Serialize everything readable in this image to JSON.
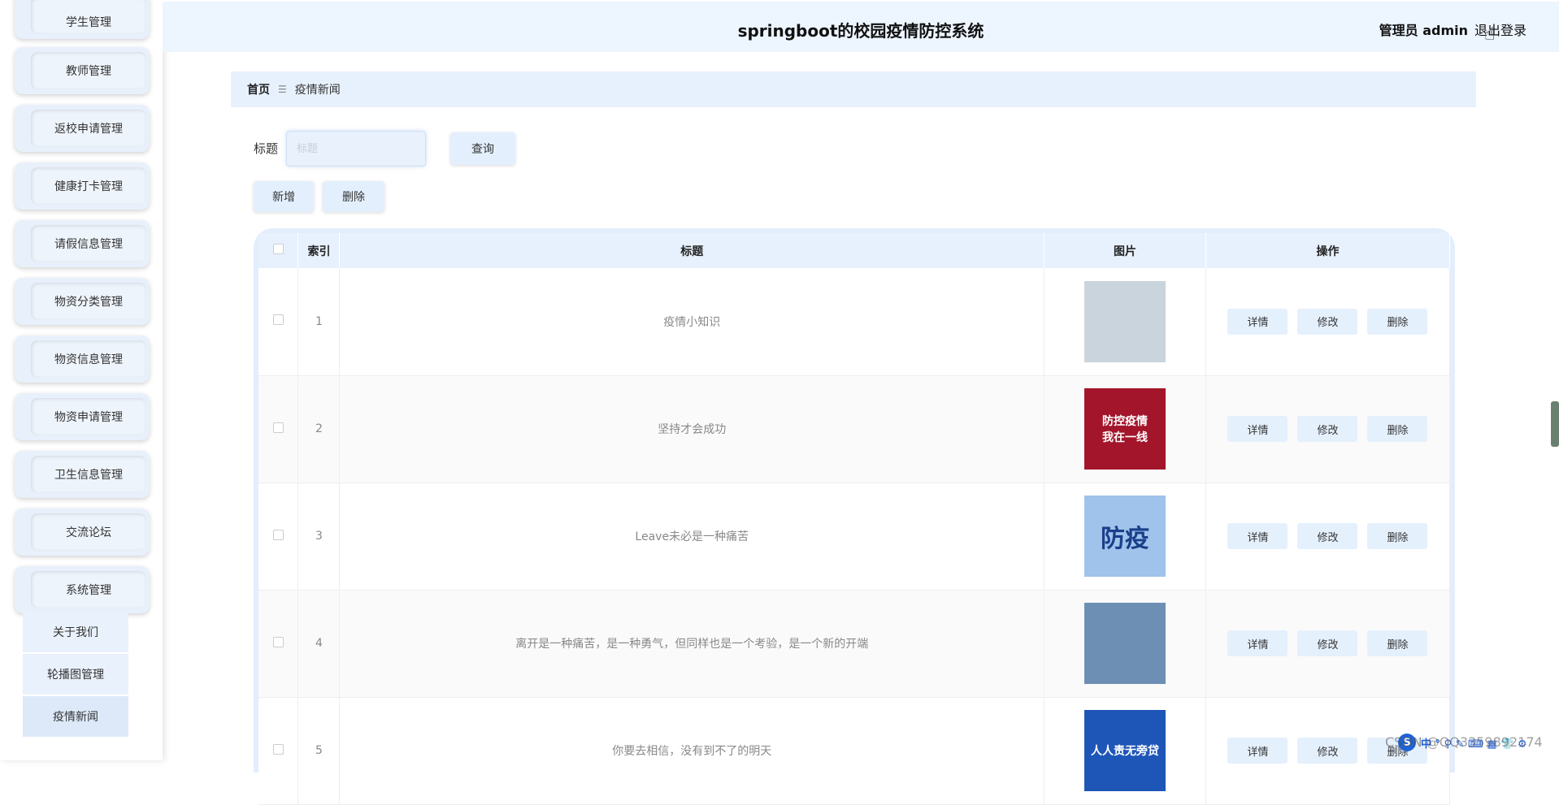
{
  "app": {
    "title": "springboot的校园疫情防控系统",
    "user": "管理员 admin",
    "logout": "退出登录"
  },
  "sidebar": {
    "items": [
      {
        "label": "学生管理"
      },
      {
        "label": "教师管理"
      },
      {
        "label": "返校申请管理"
      },
      {
        "label": "健康打卡管理"
      },
      {
        "label": "请假信息管理"
      },
      {
        "label": "物资分类管理"
      },
      {
        "label": "物资信息管理"
      },
      {
        "label": "物资申请管理"
      },
      {
        "label": "卫生信息管理"
      },
      {
        "label": "交流论坛"
      },
      {
        "label": "系统管理"
      }
    ],
    "subitems": [
      {
        "label": "关于我们"
      },
      {
        "label": "轮播图管理"
      },
      {
        "label": "疫情新闻"
      }
    ]
  },
  "breadcrumb": {
    "home": "首页",
    "separator": "☰",
    "current": "疫情新闻"
  },
  "search": {
    "label": "标题",
    "placeholder": "标题",
    "query_button": "查询"
  },
  "toolbar": {
    "add": "新增",
    "delete": "删除"
  },
  "table": {
    "columns": {
      "index": "索引",
      "title": "标题",
      "image": "图片",
      "actions": "操作"
    },
    "rows": [
      {
        "index": "1",
        "title": "疫情小知识",
        "image": {
          "icon": "doctor-photo",
          "color": "#c9d4dc",
          "text": ""
        }
      },
      {
        "index": "2",
        "title": "坚持才会成功",
        "image": {
          "icon": "prevention-poster",
          "color": "#a3152b",
          "text": "防控疫情\n我在一线"
        }
      },
      {
        "index": "3",
        "title": "Leave未必是一种痛苦",
        "image": {
          "icon": "fangyi-poster",
          "color": "#9fc3ea",
          "text": "防疫"
        }
      },
      {
        "index": "4",
        "title": "离开是一种痛苦，是一种勇气，但同样也是一个考验，是一个新的开端",
        "image": {
          "icon": "medical-worker-photo",
          "color": "#6d8fb4",
          "text": ""
        }
      },
      {
        "index": "5",
        "title": "你要去相信，没有到不了的明天",
        "image": {
          "icon": "anti-epidemic-poster",
          "color": "#1e56b8",
          "text": "人人责无旁贷"
        }
      }
    ],
    "action_labels": {
      "detail": "详情",
      "edit": "修改",
      "delete": "删除"
    }
  },
  "ime_toolbar": {
    "logo": "S",
    "label": "中 ° ⚲ ✎ ⌨ ▦ 👕 ⚙"
  },
  "watermark": "CSDN @QQ3359892174"
}
